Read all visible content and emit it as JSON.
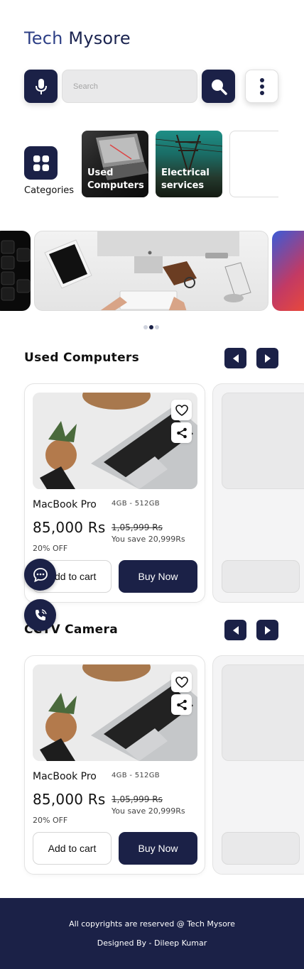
{
  "header": {
    "brand_part1": "Tech",
    "brand_part2": "Mysore",
    "brand_colors": {
      "part1": "#2d3f86",
      "part2": "#1b2450"
    }
  },
  "search": {
    "placeholder": "Search",
    "mic_icon": "microphone-icon",
    "search_icon": "search-icon",
    "menu_icon": "more-vertical-icon"
  },
  "categories": {
    "label": "Categories",
    "icon": "grid-icon",
    "items": [
      {
        "label_line1": "Used",
        "label_line2": "Computers"
      },
      {
        "label_line1": "Electrical",
        "label_line2": "services"
      }
    ]
  },
  "carousel": {
    "dot_count": 3,
    "active_dot": 1
  },
  "sections": [
    {
      "title": "Used Computers",
      "product": {
        "name": "MacBook Pro",
        "spec": "4GB - 512GB",
        "price": "85,000 Rs",
        "old_price": "1,05,999 Rs",
        "saving": "You save 20,999Rs",
        "discount": "20% OFF",
        "cart_label": "Add to cart",
        "buy_label": "Buy Now"
      }
    },
    {
      "title": "CCTV Camera",
      "product": {
        "name": "MacBook Pro",
        "spec": "4GB - 512GB",
        "price": "85,000 Rs",
        "old_price": "1,05,999 Rs",
        "saving": "You save 20,999Rs",
        "discount": "20% OFF",
        "cart_label": "Add to cart",
        "buy_label": "Buy Now"
      }
    }
  ],
  "footer": {
    "line1": "All copyrights are reserved @ Tech Mysore",
    "line2": "Designed By - Dileep Kumar"
  },
  "theme": {
    "primary": "#1b2147",
    "background": "#ffffff"
  }
}
